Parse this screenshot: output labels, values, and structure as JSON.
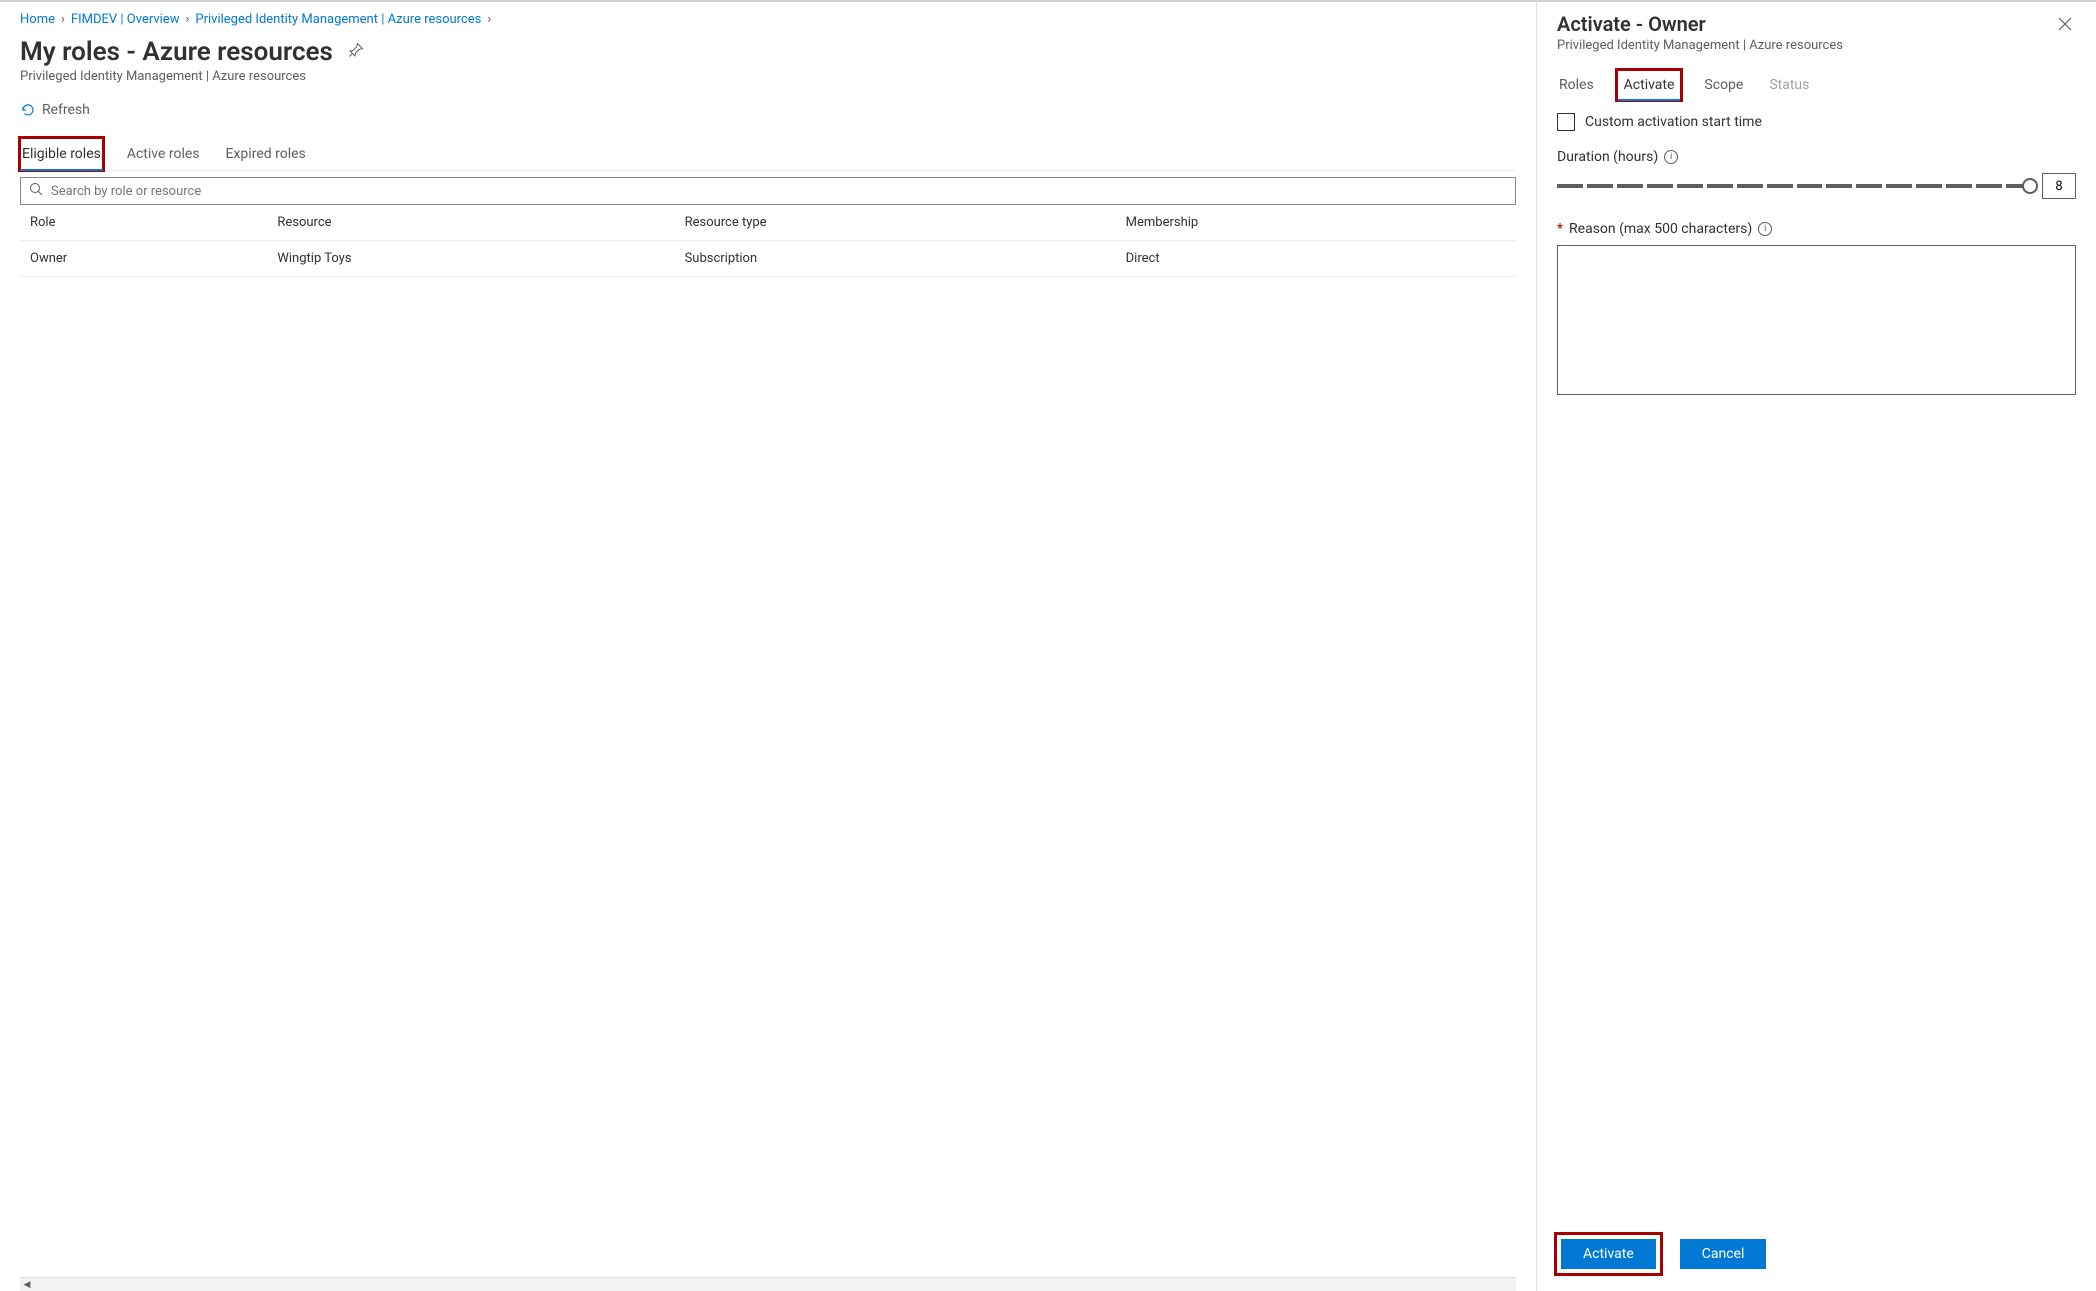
{
  "breadcrumb": {
    "items": [
      {
        "label": "Home"
      },
      {
        "label": "FIMDEV | Overview"
      },
      {
        "label": "Privileged Identity Management | Azure resources"
      }
    ]
  },
  "page": {
    "title": "My roles - Azure resources",
    "subtitle": "Privileged Identity Management | Azure resources"
  },
  "toolbar": {
    "refresh_label": "Refresh"
  },
  "tabs": {
    "eligible": "Eligible roles",
    "active": "Active roles",
    "expired": "Expired roles"
  },
  "search": {
    "placeholder": "Search by role or resource"
  },
  "table": {
    "headers": {
      "role": "Role",
      "resource": "Resource",
      "resource_type": "Resource type",
      "membership": "Membership"
    },
    "rows": [
      {
        "role": "Owner",
        "resource": "Wingtip Toys",
        "resource_type": "Subscription",
        "membership": "Direct"
      }
    ]
  },
  "panel": {
    "title": "Activate - Owner",
    "subtitle": "Privileged Identity Management | Azure resources",
    "tabs": {
      "roles": "Roles",
      "activate": "Activate",
      "scope": "Scope",
      "status": "Status"
    },
    "custom_start_label": "Custom activation start time",
    "duration_label": "Duration (hours)",
    "duration_value": "8",
    "reason_label": "Reason (max 500 characters)",
    "buttons": {
      "activate": "Activate",
      "cancel": "Cancel"
    }
  }
}
